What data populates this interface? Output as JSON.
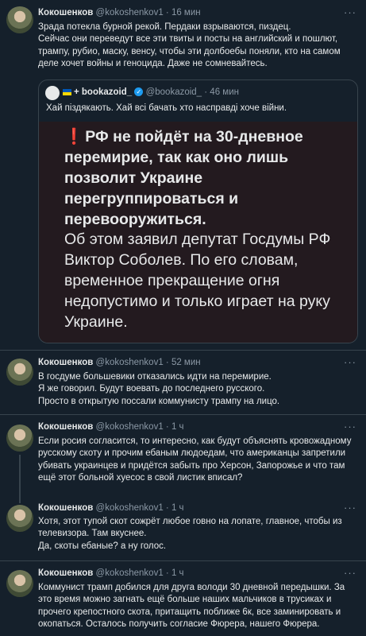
{
  "tweets": [
    {
      "name": "Кокошенков",
      "handle": "@kokoshenkov1",
      "time": "· 16 мин",
      "text": "Зрада потекла бурной рекой. Пердаки взрываются, пиздец.\nСейчас они переведут все эти твиты и посты на английский и пошлют, трампу, рубио, маску, венсу, чтобы эти долбоебы поняли, кто на самом деле хочет войны и геноцида. Даже не сомневайтесь.",
      "quote": {
        "name": "+ bookazoid_",
        "handle": "@bookazoid_",
        "time": "· 46 мин",
        "text": "Хай пiздякають. Хай всi бачать хто насправдi хоче вiйни.",
        "image_headline": "РФ не пойдёт на 30-дневное перемирие, так как оно лишь позволит Украине перегруппироваться и перевооружиться.",
        "image_body": "Об этом заявил депутат Госдумы РФ Виктор Соболев. По его словам, временное прекращение огня недопустимо и только играет на руку Украине."
      }
    },
    {
      "name": "Кокошенков",
      "handle": "@kokoshenkov1",
      "time": "· 52 мин",
      "text": "В госдуме большевики отказались идти на перемирие.\nЯ же говорил. Будут воевать до последнего русского.\nПросто в открытую поссали коммунисту трампу на лицо."
    },
    {
      "name": "Кокошенков",
      "handle": "@kokoshenkov1",
      "time": "· 1 ч",
      "text": "Если росия согласится, то интересно, как будут объяснять кровожадному русскому скоту и прочим ебаным людоедам, что американцы запретили убивать украинцев и придётся забыть про Херсон, Запорожье и что там ещё этот больной хуесос в свой листик вписал?"
    },
    {
      "name": "Кокошенков",
      "handle": "@kokoshenkov1",
      "time": "· 1 ч",
      "text": "Хотя, этот тупой скот сожрёт любое говно на лопате, главное, чтобы из телевизора. Там вкуснее.\nДа, скоты ебаные? а ну голос."
    },
    {
      "name": "Кокошенков",
      "handle": "@kokoshenkov1",
      "time": "· 1 ч",
      "text": "Коммунист трамп добился для друга володи 30 дневной передышки. За это время можно загнать ещё больше наших мальчиков в трусиках и прочего крепостного скота, притащить поближе 6к, все заминировать и окопаться. Осталось получить согласие Фюрера, нашего Фюрера."
    }
  ],
  "more_icon": "···",
  "quote_exclamation": "❗",
  "verified_icon": "✓"
}
